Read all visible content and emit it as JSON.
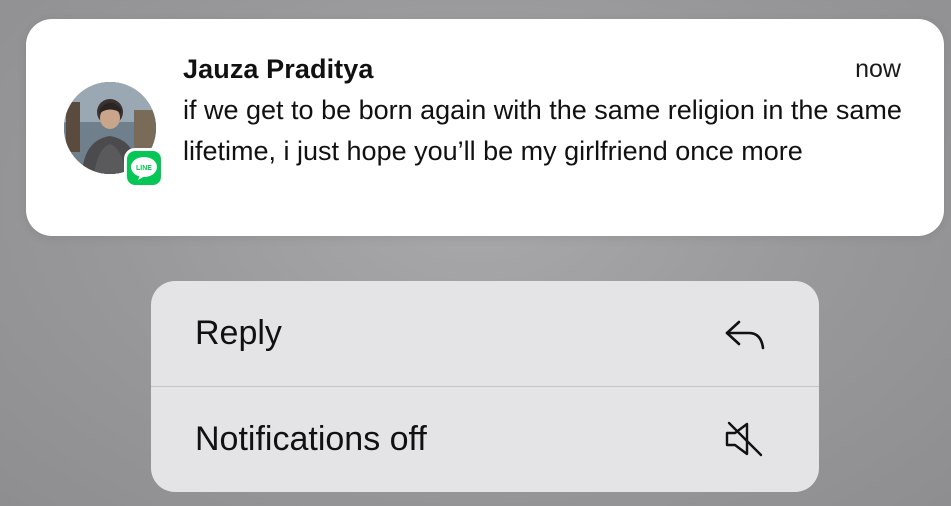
{
  "notification": {
    "sender": "Jauza Praditya",
    "time": "now",
    "message": "if we get to be born again with the same religion in the same lifetime, i just hope you’ll be my girlfriend once more",
    "app_icon": "line-app-icon",
    "app_badge_text": "LINE",
    "accent_color": "#06c755"
  },
  "menu": {
    "items": [
      {
        "label": "Reply",
        "icon": "reply-arrow-icon"
      },
      {
        "label": "Notifications off",
        "icon": "speaker-muted-icon"
      }
    ]
  }
}
